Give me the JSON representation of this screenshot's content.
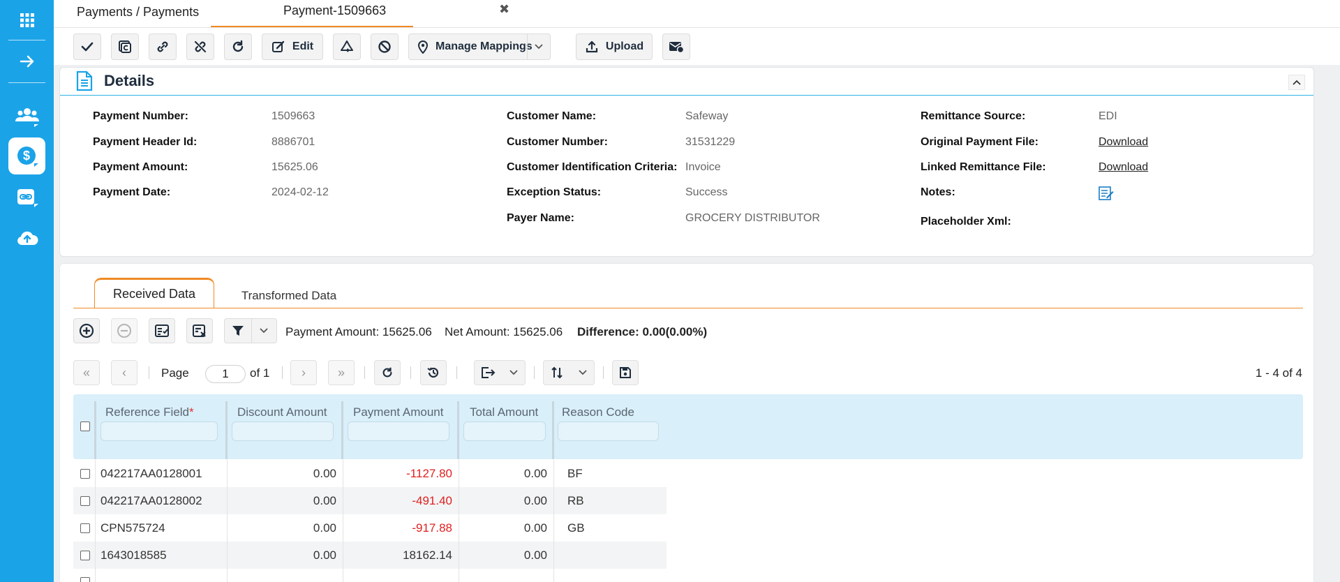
{
  "breadcrumb": "Payments / Payments",
  "active_tab": {
    "label": "Payment-1509663",
    "close": "✖"
  },
  "toolbar": {
    "edit_label": "Edit",
    "manage_mappings_label": "Manage Mappings",
    "upload_label": "Upload"
  },
  "details": {
    "title": "Details",
    "fields": {
      "payment_number_label": "Payment Number:",
      "payment_number": "1509663",
      "payment_header_id_label": "Payment Header Id:",
      "payment_header_id": "8886701",
      "payment_amount_label": "Payment Amount:",
      "payment_amount": "15625.06",
      "payment_date_label": "Payment Date:",
      "payment_date": "2024-02-12",
      "customer_name_label": "Customer Name:",
      "customer_name": "Safeway",
      "customer_number_label": "Customer Number:",
      "customer_number": "31531229",
      "customer_id_criteria_label": "Customer Identification Criteria:",
      "customer_id_criteria": "Invoice",
      "exception_status_label": "Exception Status:",
      "exception_status": "Success",
      "payer_name_label": "Payer Name:",
      "payer_name": "GROCERY DISTRIBUTOR",
      "remittance_source_label": "Remittance Source:",
      "remittance_source": "EDI",
      "original_payment_file_label": "Original Payment File:",
      "original_payment_file": "Download",
      "linked_remittance_file_label": "Linked Remittance File:",
      "linked_remittance_file": "Download",
      "notes_label": "Notes:",
      "placeholder_xml_label": "Placeholder Xml:"
    }
  },
  "data_tabs": [
    "Received Data",
    "Transformed Data"
  ],
  "summary": {
    "payment_amount": "Payment Amount: 15625.06",
    "net_amount": "Net Amount: 15625.06",
    "difference": "Difference: 0.00(0.00%)"
  },
  "pager": {
    "page_label": "Page",
    "page_value": "1",
    "of_label": "of 1",
    "range": "1 - 4 of 4"
  },
  "columns": [
    "Reference Field",
    "Discount Amount",
    "Payment Amount",
    "Total Amount",
    "Reason Code"
  ],
  "required_marker": "*",
  "rows": [
    {
      "reference": "042217AA0128001",
      "discount": "0.00",
      "payment": "-1127.80",
      "total": "0.00",
      "reason": "BF"
    },
    {
      "reference": "042217AA0128002",
      "discount": "0.00",
      "payment": "-491.40",
      "total": "0.00",
      "reason": "RB"
    },
    {
      "reference": "CPN575724",
      "discount": "0.00",
      "payment": "-917.88",
      "total": "0.00",
      "reason": "GB"
    },
    {
      "reference": "1643018585",
      "discount": "0.00",
      "payment": "18162.14",
      "total": "0.00",
      "reason": ""
    }
  ],
  "colors": {
    "sidebar": "#1ba3e8",
    "accent_orange": "#f08a24",
    "negative": "#e02020",
    "grid_header": "#d9effa"
  }
}
